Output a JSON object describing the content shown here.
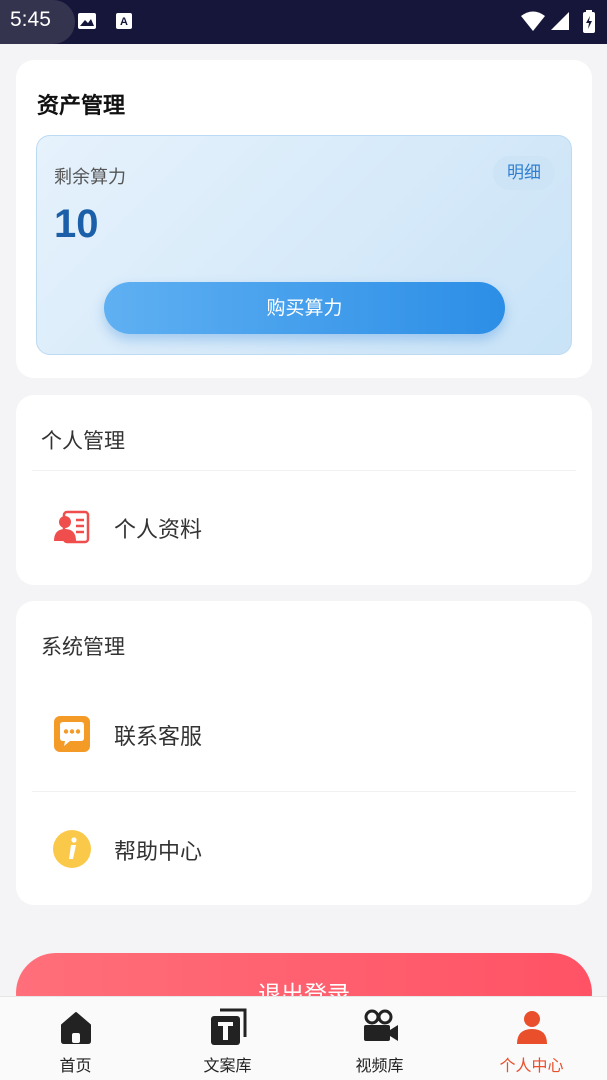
{
  "status_bar": {
    "time": "5:45"
  },
  "assets": {
    "title": "资产管理",
    "compute_label": "剩余算力",
    "detail_label": "明细",
    "compute_value": "10",
    "buy_label": "购买算力"
  },
  "personal": {
    "title": "个人管理",
    "items": [
      {
        "label": "个人资料",
        "icon": "profile-card-icon"
      }
    ]
  },
  "system": {
    "title": "系统管理",
    "items": [
      {
        "label": "联系客服",
        "icon": "chat-bubble-icon"
      },
      {
        "label": "帮助中心",
        "icon": "info-icon"
      }
    ]
  },
  "logout_label": "退出登录",
  "tabs": [
    {
      "label": "首页",
      "icon": "home-icon",
      "active": false
    },
    {
      "label": "文案库",
      "icon": "text-library-icon",
      "active": false
    },
    {
      "label": "视频库",
      "icon": "video-camera-icon",
      "active": false
    },
    {
      "label": "个人中心",
      "icon": "person-icon",
      "active": true
    }
  ],
  "colors": {
    "accent": "#e94f2b",
    "primary_blue": "#2c8ee6",
    "logout_red": "#ff5265",
    "value_blue": "#1a5fa8"
  }
}
